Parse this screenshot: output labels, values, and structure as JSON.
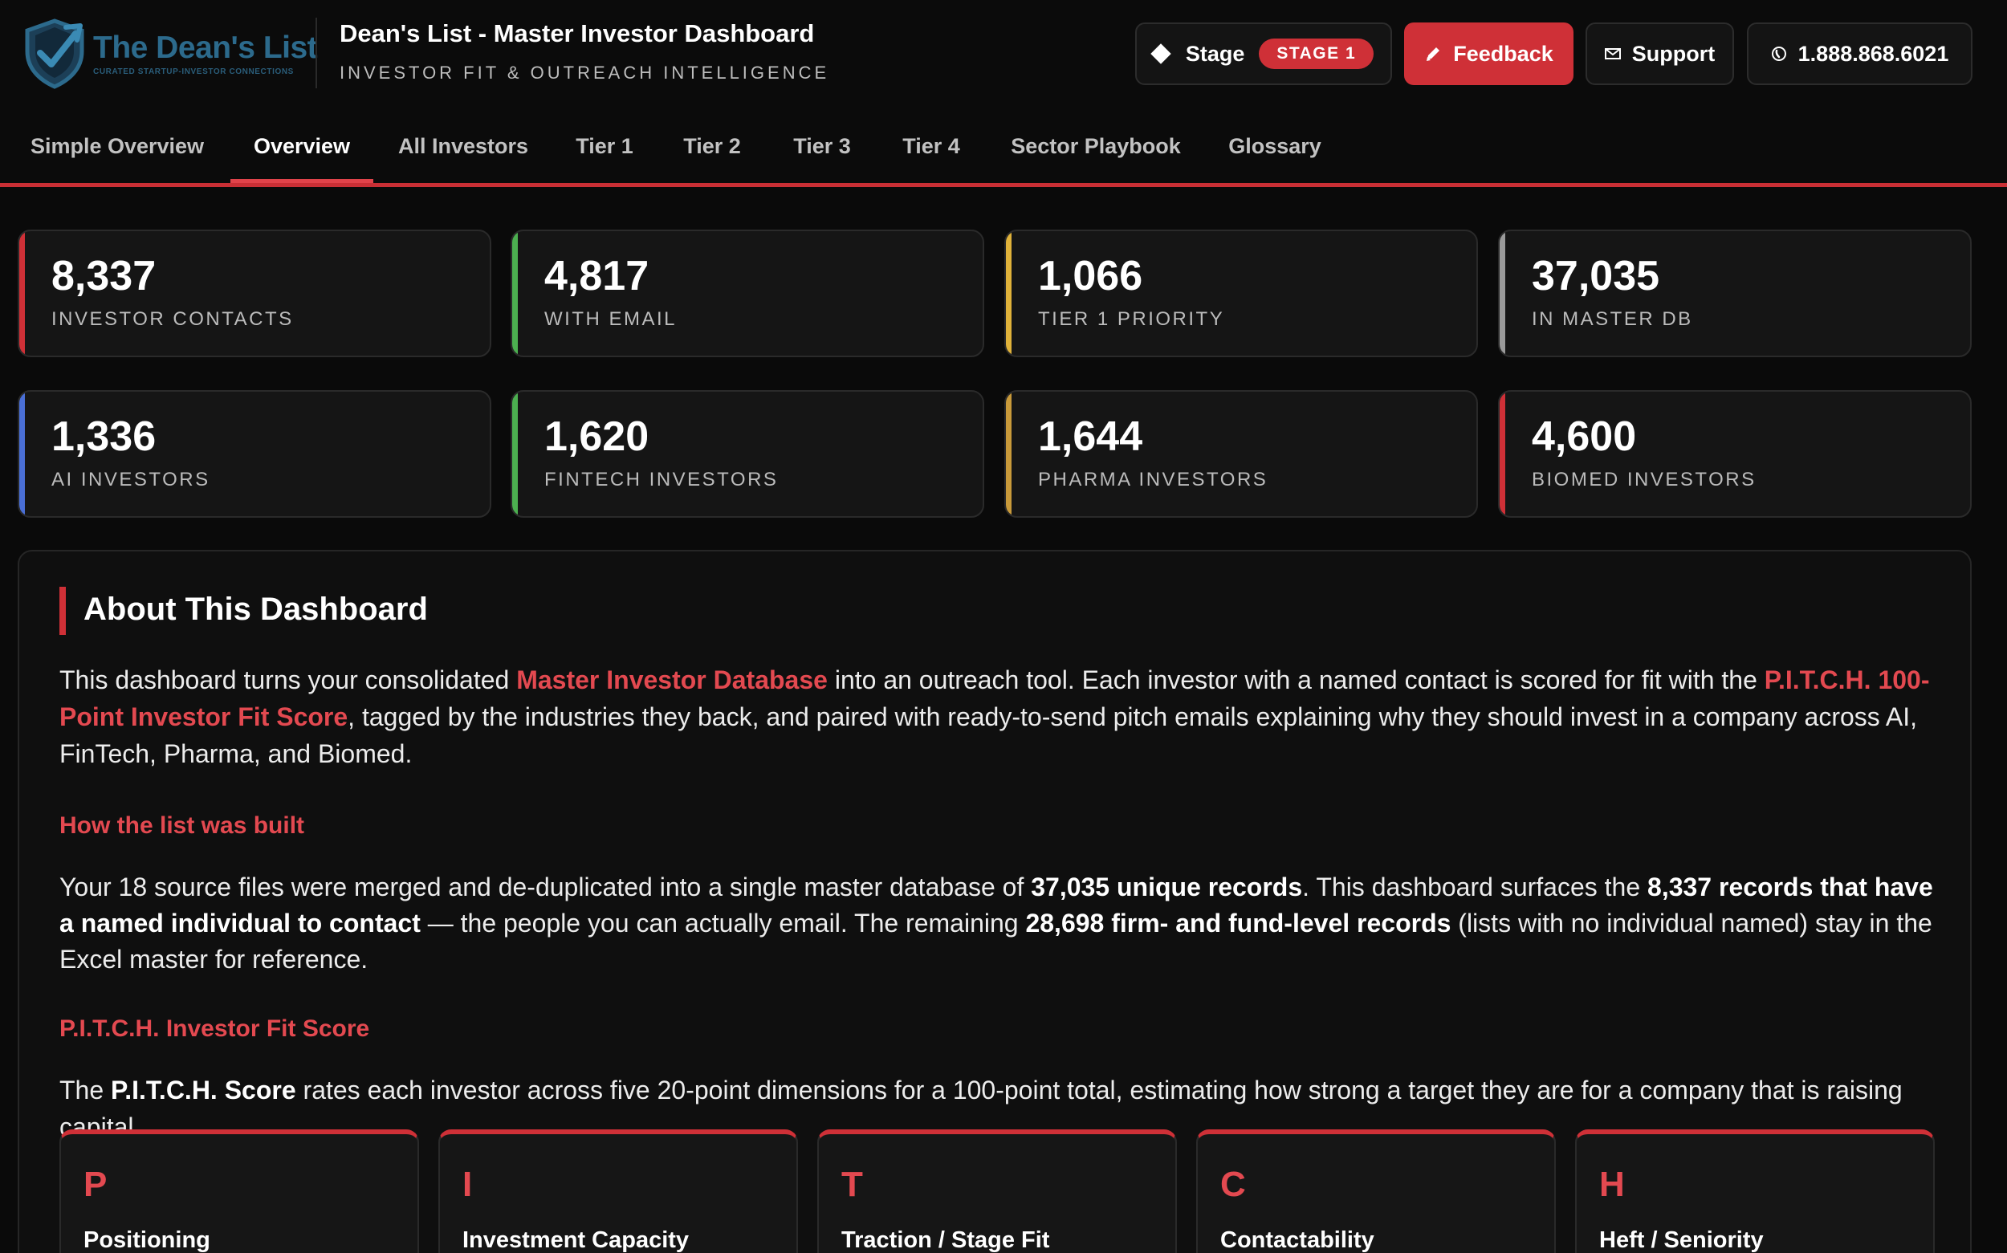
{
  "brand": {
    "logo_title": "The Dean's List",
    "logo_subtitle": "CURATED STARTUP-INVESTOR CONNECTIONS",
    "logo_color": "#2c6a8c"
  },
  "header": {
    "title": "Dean's List - Master Investor Dashboard",
    "subtitle": "INVESTOR FIT & OUTREACH INTELLIGENCE",
    "stage_label": "Stage",
    "stage_value": "STAGE 1",
    "feedback_label": "Feedback",
    "support_label": "Support",
    "phone_label": "1.888.868.6021",
    "accent_color": "#cf3037"
  },
  "tabs": [
    {
      "label": "Simple Overview"
    },
    {
      "label": "Overview",
      "active": true
    },
    {
      "label": "All Investors"
    },
    {
      "label": "Tier 1"
    },
    {
      "label": "Tier 2"
    },
    {
      "label": "Tier 3"
    },
    {
      "label": "Tier 4"
    },
    {
      "label": "Sector Playbook"
    },
    {
      "label": "Glossary"
    }
  ],
  "stats": [
    {
      "value": "8,337",
      "label": "INVESTOR CONTACTS",
      "color": "#cf3037"
    },
    {
      "value": "4,817",
      "label": "WITH EMAIL",
      "color": "#4caf50"
    },
    {
      "value": "1,066",
      "label": "TIER 1 PRIORITY",
      "color": "#e0b23a"
    },
    {
      "value": "37,035",
      "label": "IN MASTER DB",
      "color": "#9a9a9a"
    },
    {
      "value": "1,336",
      "label": "AI INVESTORS",
      "color": "#4a6fd6"
    },
    {
      "value": "1,620",
      "label": "FINTECH INVESTORS",
      "color": "#4caf50"
    },
    {
      "value": "1,644",
      "label": "PHARMA INVESTORS",
      "color": "#c99a3a"
    },
    {
      "value": "4,600",
      "label": "BIOMED INVESTORS",
      "color": "#cf3037"
    }
  ],
  "about": {
    "title": "About This Dashboard",
    "intro_1": "This dashboard turns your consolidated ",
    "intro_hl_1": "Master Investor Database",
    "intro_2": " into an outreach tool. Each investor with a named contact is scored for fit with the ",
    "intro_hl_2": "P.I.T.C.H. 100-Point Investor Fit Score",
    "intro_3": ", tagged by the industries they back, and paired with ready-to-send pitch emails explaining why they should invest in a company across AI, FinTech, Pharma, and Biomed.",
    "built_heading": "How the list was built",
    "built_1": "Your 18 source files were merged and de-duplicated into a single master database of ",
    "built_b1": "37,035 unique records",
    "built_2": ". This dashboard surfaces the ",
    "built_b2": "8,337 records that have a named individual to contact",
    "built_3": " — the people you can actually email. The remaining ",
    "built_b3": "28,698 firm- and fund-level records",
    "built_4": " (lists with no individual named) stay in the Excel master for reference.",
    "score_heading": "P.I.T.C.H. Investor Fit Score",
    "score_1": "The ",
    "score_b1": "P.I.T.C.H. Score",
    "score_2": " rates each investor across five 20-point dimensions for a 100-point total, estimating how strong a target they are for a company that is raising capital.",
    "pitch": [
      {
        "letter": "P",
        "name": "Positioning"
      },
      {
        "letter": "I",
        "name": "Investment Capacity"
      },
      {
        "letter": "T",
        "name": "Traction / Stage Fit"
      },
      {
        "letter": "C",
        "name": "Contactability"
      },
      {
        "letter": "H",
        "name": "Heft / Seniority"
      }
    ]
  }
}
